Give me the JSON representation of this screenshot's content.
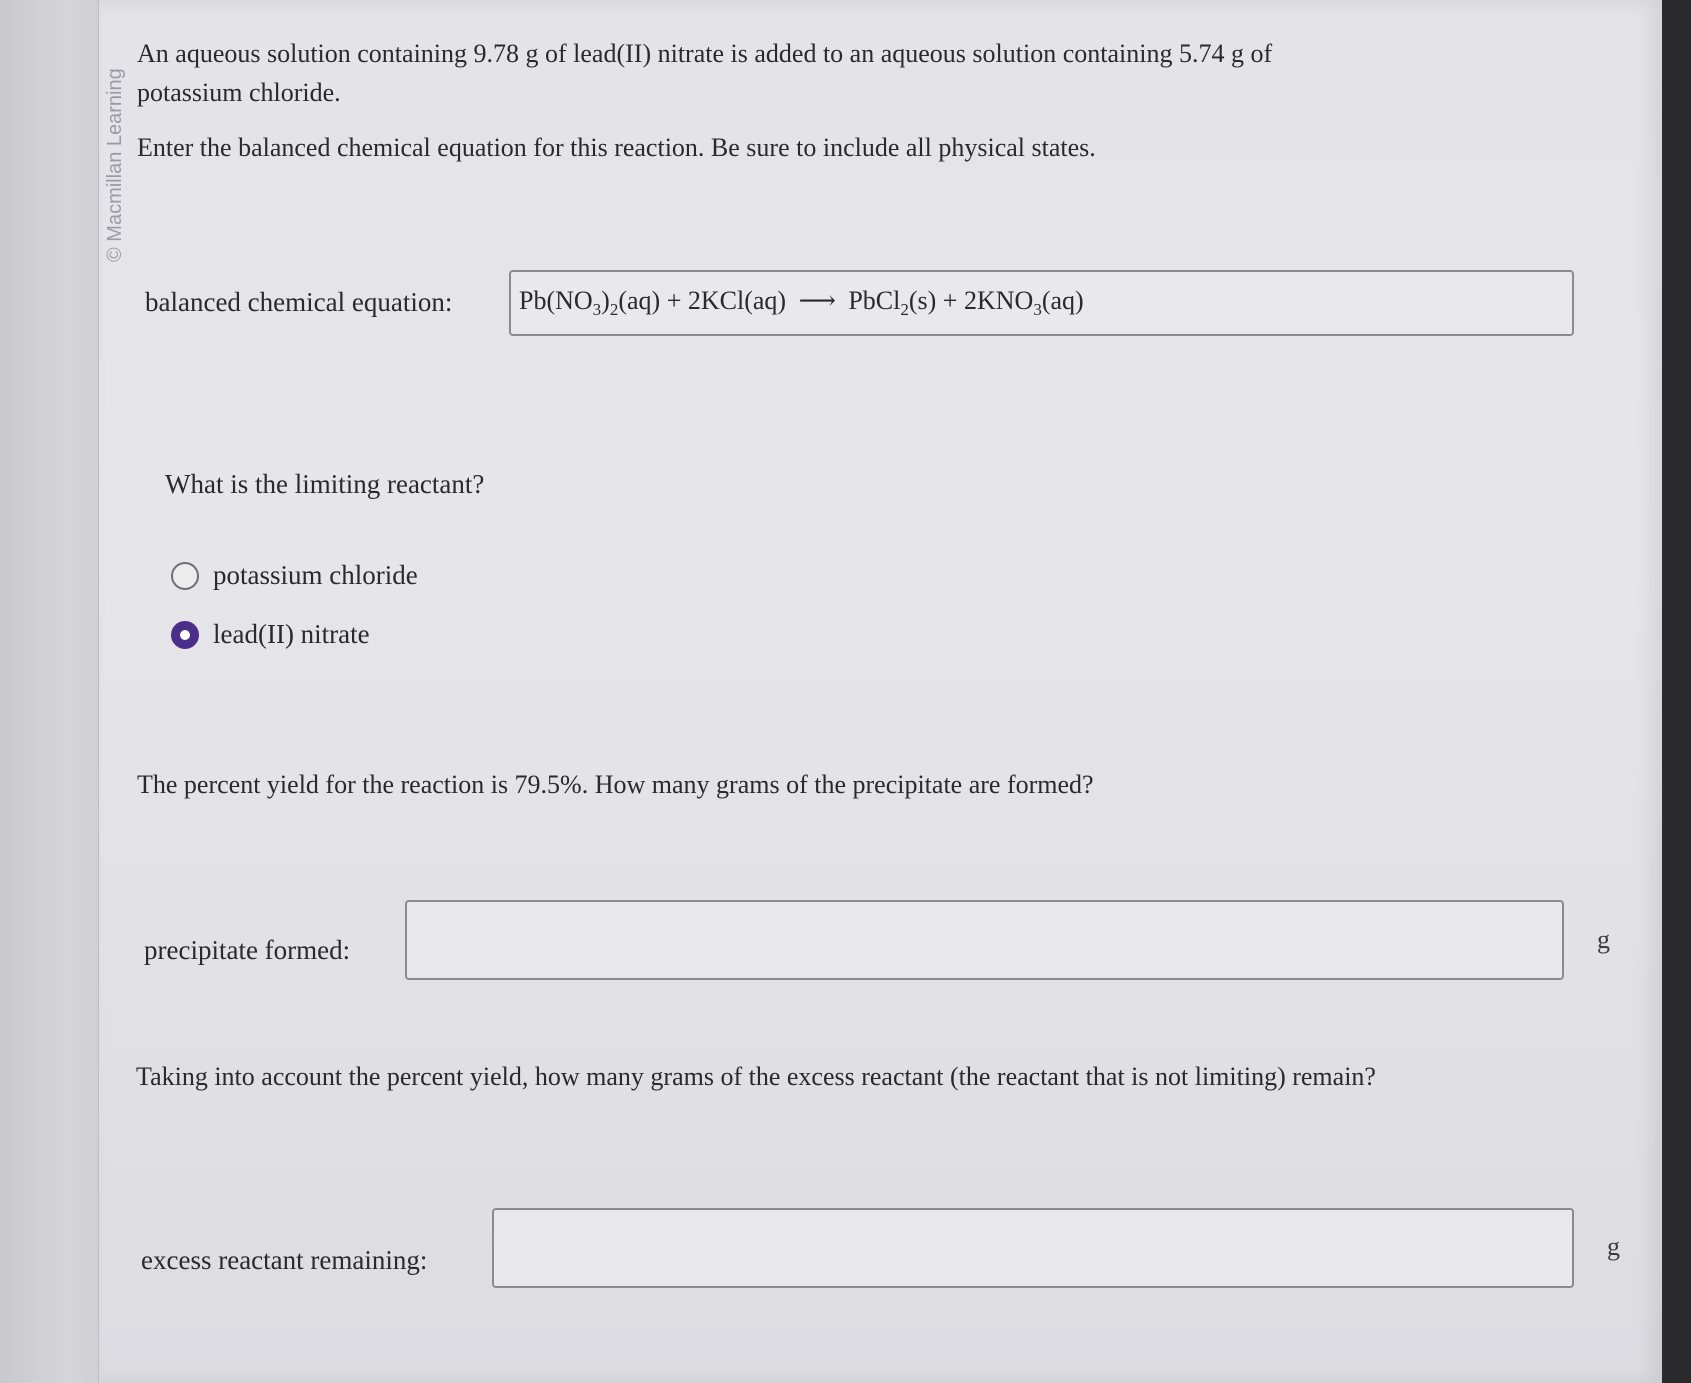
{
  "watermark": "© Macmillan Learning",
  "intro": {
    "line1": "An aqueous solution containing 9.78 g of lead(II) nitrate is added to an aqueous solution containing 5.74 g of",
    "line2": "potassium chloride.",
    "instruction": "Enter the balanced chemical equation for this reaction. Be sure to include all physical states."
  },
  "equation": {
    "label": "balanced chemical equation:",
    "lhs1": "Pb(NO",
    "sub1": "3",
    "mid1": ")",
    "sub2": "2",
    "state1": "(aq) + 2KCl(aq)",
    "arrow": "⟶",
    "rhs1": "PbCl",
    "sub3": "2",
    "state2": "(s) + 2KNO",
    "sub4": "3",
    "state3": "(aq)"
  },
  "limiting": {
    "question": "What is the limiting reactant?",
    "options": [
      {
        "label": "potassium chloride",
        "selected": false
      },
      {
        "label": "lead(II) nitrate",
        "selected": true
      }
    ]
  },
  "yield_question": "The percent yield for the reaction is 79.5%. How many grams of the precipitate are formed?",
  "precipitate": {
    "label": "precipitate formed:",
    "value": "",
    "unit": "g"
  },
  "excess_question": "Taking into account the percent yield, how many grams of the excess reactant (the reactant that is not limiting) remain?",
  "excess": {
    "label": "excess reactant remaining:",
    "value": "",
    "unit": "g"
  },
  "colors": {
    "radio_selected": "#4b2d8a",
    "page_bg": "#e5e5e9"
  }
}
